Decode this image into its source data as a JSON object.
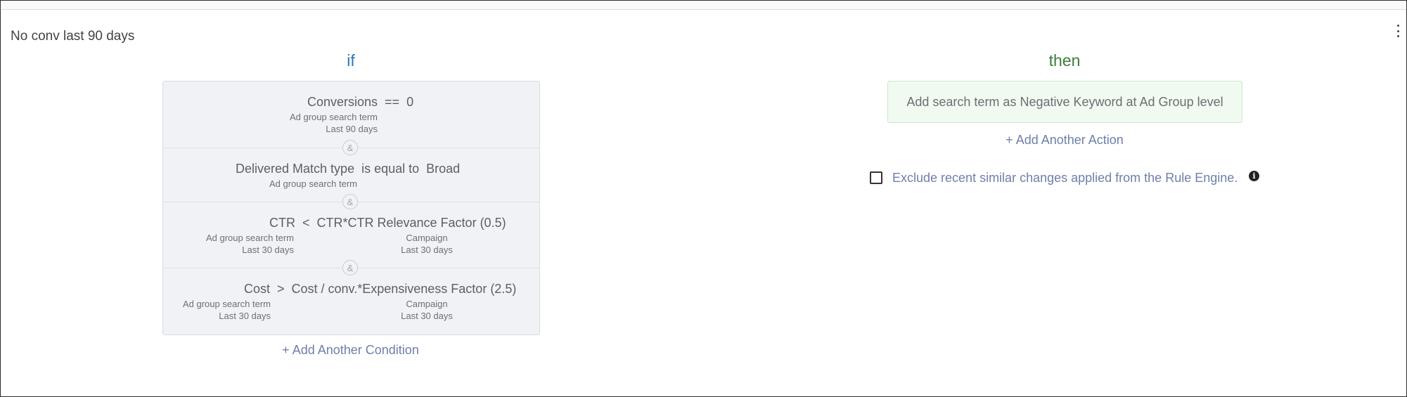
{
  "rule": {
    "title": "No conv last 90 days"
  },
  "if_section": {
    "heading": "if",
    "conditions": [
      {
        "text": "Conversions  ==  0",
        "left_sub": [
          "Ad group search term",
          "Last 90 days"
        ],
        "right_sub": []
      },
      {
        "text": "Delivered Match type  is equal to  Broad",
        "left_sub": [
          "Ad group search term"
        ],
        "right_sub": []
      },
      {
        "text": "CTR  <  CTR*CTR Relevance Factor (0.5)",
        "left_sub": [
          "Ad group search term",
          "Last 30 days"
        ],
        "right_sub": [
          "Campaign",
          "Last 30 days"
        ]
      },
      {
        "text": "Cost  >  Cost / conv.*Expensiveness Factor (2.5)",
        "left_sub": [
          "Ad group search term",
          "Last 30 days"
        ],
        "right_sub": [
          "Campaign",
          "Last 30 days"
        ]
      }
    ],
    "and_symbol": "&",
    "add_condition_label": "+ Add Another Condition"
  },
  "then_section": {
    "heading": "then",
    "action_text": "Add search term as Negative Keyword at Ad Group level",
    "add_action_label": "+ Add Another Action",
    "exclude_label": "Exclude recent similar changes applied from the Rule Engine.",
    "exclude_checked": false,
    "info_icon": "i"
  },
  "colors": {
    "if_heading": "#2e77b8",
    "then_heading": "#3c7d3c",
    "link": "#6e7fa8",
    "condition_bg": "#f1f2f5",
    "action_bg": "#f1faf0"
  },
  "icons": {
    "menu": "kebab-menu-icon",
    "info": "info-icon"
  }
}
